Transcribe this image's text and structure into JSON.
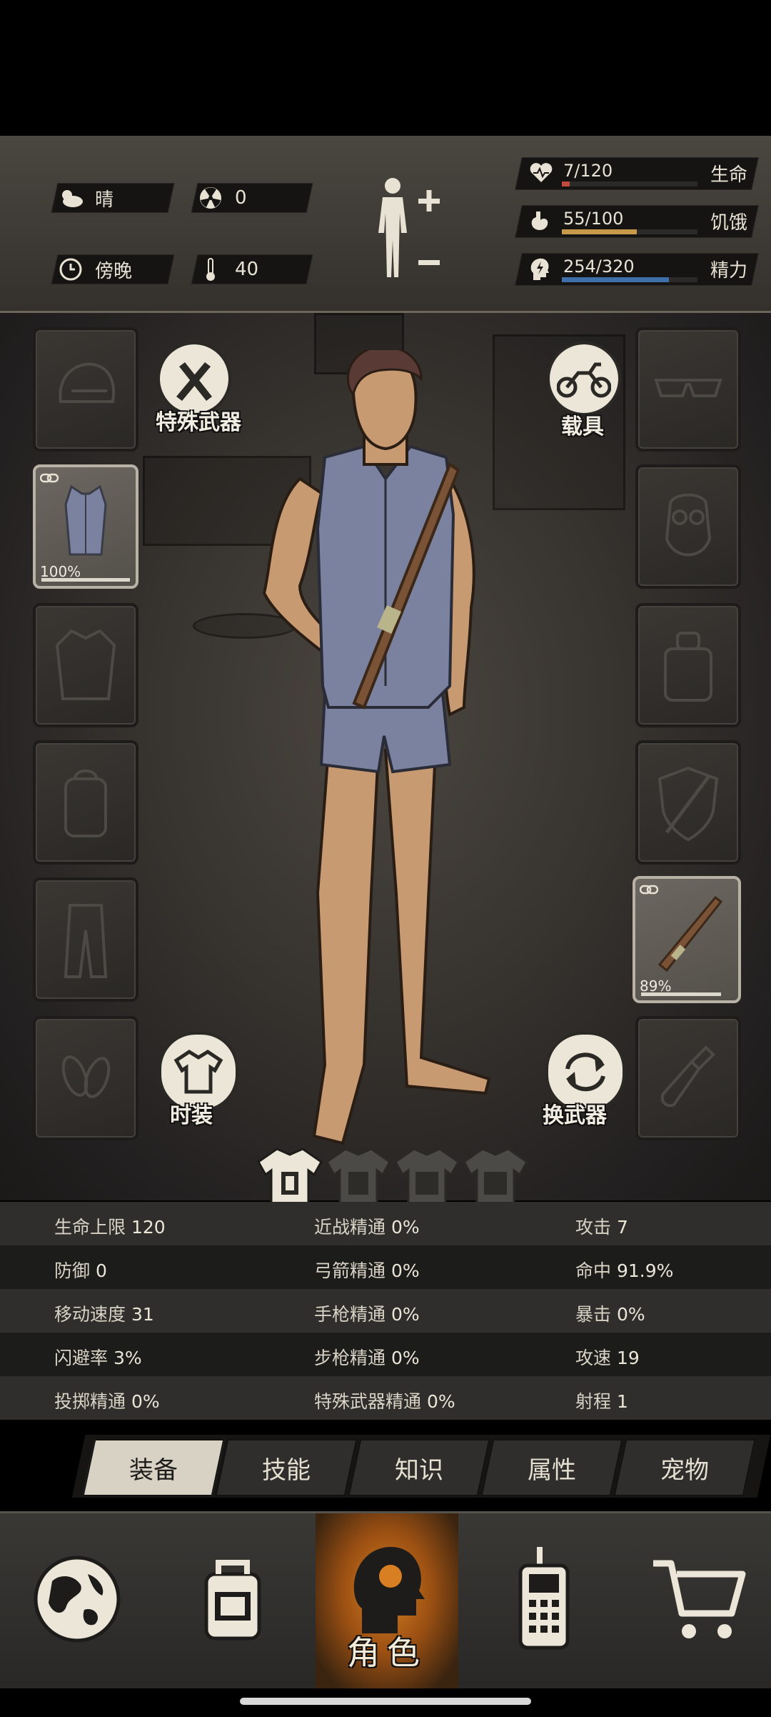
{
  "status": {
    "weather": "晴",
    "radiation": "0",
    "time_of_day": "傍晚",
    "temperature": "40",
    "health": {
      "value": "7/120",
      "label": "生命",
      "ratio": 0.058,
      "color": "#c24a3c"
    },
    "hunger": {
      "value": "55/100",
      "label": "饥饿",
      "ratio": 0.55,
      "color": "#c79a4a"
    },
    "energy": {
      "value": "254/320",
      "label": "精力",
      "ratio": 0.79,
      "color": "#3f6fa8"
    }
  },
  "equipment": {
    "special_weapon_label": "特殊武器",
    "vehicle_label": "载具",
    "fashion_label": "时装",
    "swap_weapon_label": "换武器",
    "shirt_durability": "100%",
    "shirt_durability_ratio": 1.0,
    "weapon_durability": "89%",
    "weapon_durability_ratio": 0.89,
    "outfit_tabs": [
      "I",
      "II",
      "III",
      "IV"
    ]
  },
  "stats": {
    "rows": [
      [
        {
          "label": "生命上限",
          "value": "120"
        },
        {
          "label": "近战精通",
          "value": "0%"
        },
        {
          "label": "攻击",
          "value": "7"
        }
      ],
      [
        {
          "label": "防御",
          "value": "0"
        },
        {
          "label": "弓箭精通",
          "value": "0%"
        },
        {
          "label": "命中",
          "value": "91.9%"
        }
      ],
      [
        {
          "label": "移动速度",
          "value": "31"
        },
        {
          "label": "手枪精通",
          "value": "0%"
        },
        {
          "label": "暴击",
          "value": "0%"
        }
      ],
      [
        {
          "label": "闪避率",
          "value": "3%"
        },
        {
          "label": "步枪精通",
          "value": "0%"
        },
        {
          "label": "攻速",
          "value": "19"
        }
      ],
      [
        {
          "label": "投掷精通",
          "value": "0%"
        },
        {
          "label": "特殊武器精通",
          "value": "0%"
        },
        {
          "label": "射程",
          "value": "1"
        }
      ]
    ]
  },
  "tabs": [
    "装备",
    "技能",
    "知识",
    "属性",
    "宠物"
  ],
  "active_tab": "装备",
  "nav": {
    "active_label": "角色",
    "items": [
      "world-map-icon",
      "backpack-icon",
      "character-icon",
      "radio-icon",
      "cart-icon"
    ]
  }
}
